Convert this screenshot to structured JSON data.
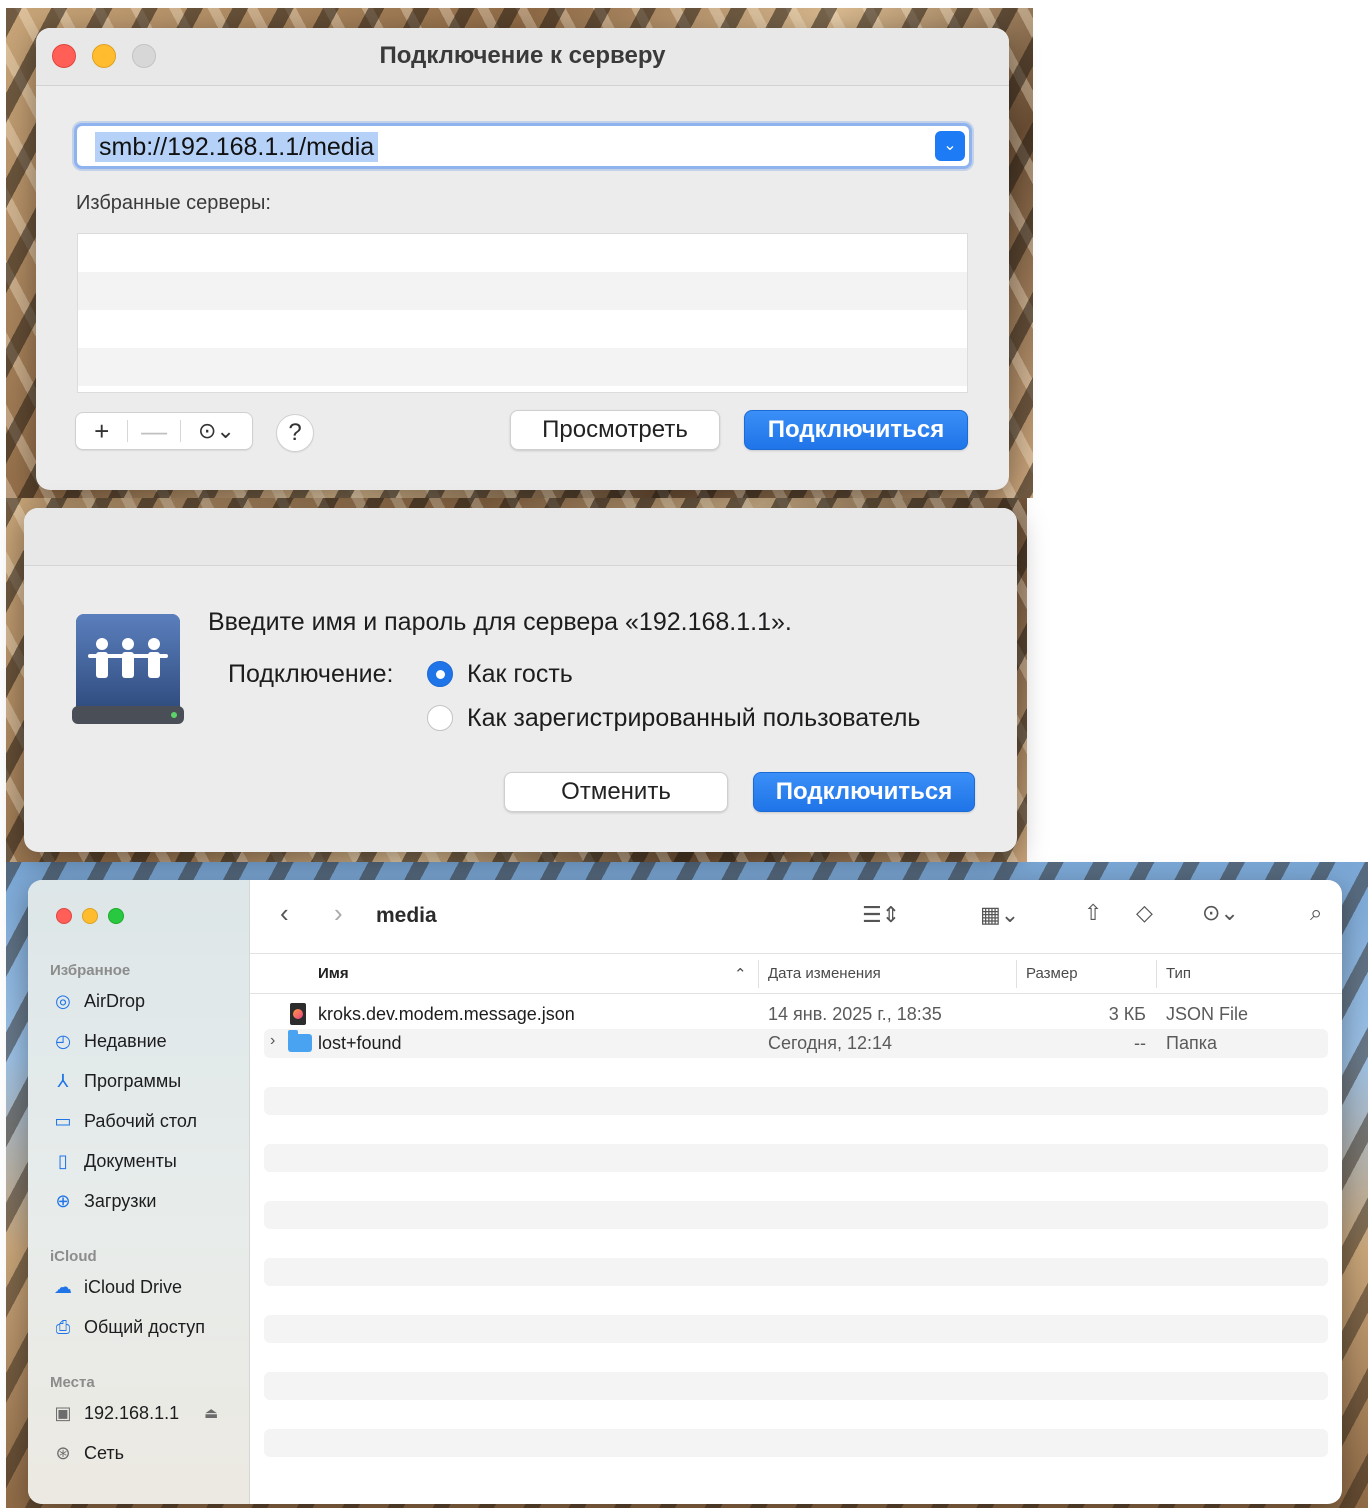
{
  "connect_window": {
    "title": "Подключение к серверу",
    "address": "smb://192.168.1.1/media",
    "favorites_label": "Избранные серверы:",
    "add_label": "+",
    "remove_label": "—",
    "more_label": "⊙⌄",
    "help_label": "?",
    "browse_label": "Просмотреть",
    "connect_label": "Подключиться"
  },
  "auth_window": {
    "message": "Введите имя и пароль для сервера «192.168.1.1».",
    "connect_as_label": "Подключение:",
    "guest_label": "Как гость",
    "registered_label": "Как зарегистрированный пользователь",
    "selected": "guest",
    "cancel_label": "Отменить",
    "connect_label": "Подключиться"
  },
  "finder": {
    "path_title": "media",
    "sidebar": {
      "favorites_header": "Избранное",
      "favorites": [
        {
          "label": "AirDrop",
          "icon": "airdrop-icon"
        },
        {
          "label": "Недавние",
          "icon": "clock-icon"
        },
        {
          "label": "Программы",
          "icon": "apps-icon"
        },
        {
          "label": "Рабочий стол",
          "icon": "desktop-icon"
        },
        {
          "label": "Документы",
          "icon": "document-icon"
        },
        {
          "label": "Загрузки",
          "icon": "download-icon"
        }
      ],
      "icloud_header": "iCloud",
      "icloud": [
        {
          "label": "iCloud Drive",
          "icon": "cloud-icon"
        },
        {
          "label": "Общий доступ",
          "icon": "shared-folder-icon"
        }
      ],
      "places_header": "Места",
      "places": [
        {
          "label": "192.168.1.1",
          "icon": "server-icon"
        },
        {
          "label": "Сеть",
          "icon": "globe-icon"
        }
      ]
    },
    "columns": {
      "name": "Имя",
      "modified": "Дата изменения",
      "size": "Размер",
      "kind": "Тип"
    },
    "files": [
      {
        "name": "kroks.dev.modem.message.json",
        "modified": "14 янв. 2025 г., 18:35",
        "size": "3 КБ",
        "kind": "JSON File"
      },
      {
        "name": "lost+found",
        "modified": "Сегодня, 12:14",
        "size": "--",
        "kind": "Папка"
      }
    ]
  }
}
